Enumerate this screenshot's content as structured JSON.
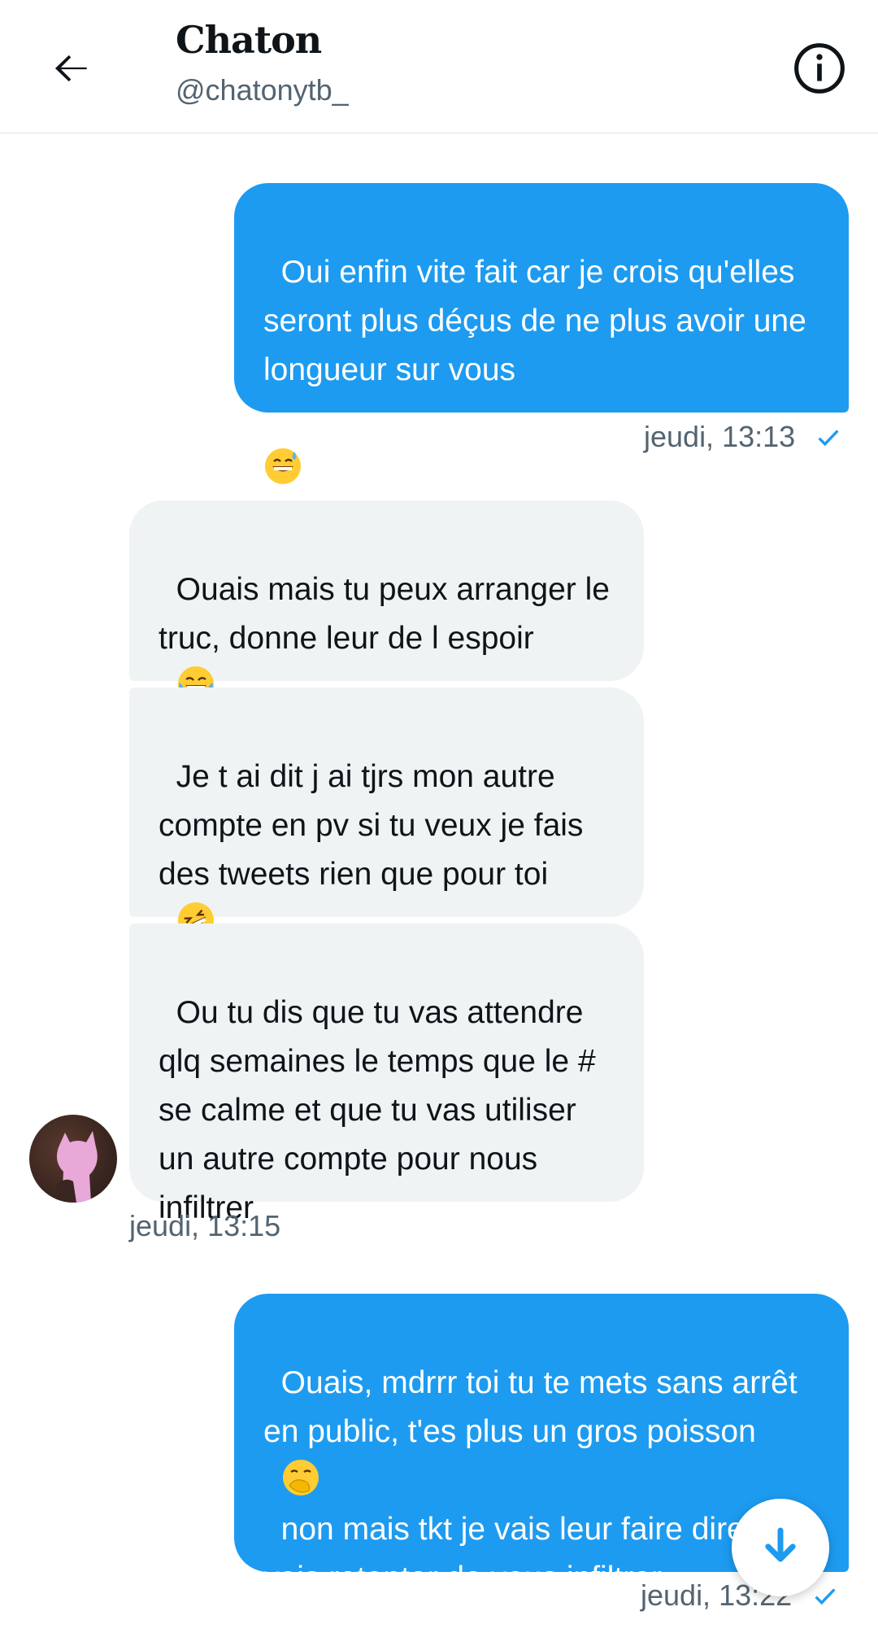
{
  "header": {
    "title": "Chaton",
    "handle": "@chatonytb_",
    "back_icon": "arrow-left-icon",
    "info_icon": "info-icon"
  },
  "colors": {
    "accent": "#1d9bf0",
    "received_bubble": "#eff3f4",
    "secondary_text": "#536471"
  },
  "messages": [
    {
      "direction": "sent",
      "text": "Oui enfin vite fait car je crois qu'elles seront plus déçus de ne plus avoir une longueur sur vous",
      "emoji": "grinning-sweat-emoji",
      "timestamp": "jeudi, 13:13",
      "status": "sent-check-icon"
    },
    {
      "direction": "received",
      "text": "Ouais mais tu peux arranger le truc, donne leur de l espoir",
      "emoji": "tears-of-joy-emoji"
    },
    {
      "direction": "received",
      "text": "Je t ai dit j ai tjrs mon autre compte en pv si tu veux je fais des tweets rien que pour toi",
      "emoji": "rolling-laughing-emoji"
    },
    {
      "direction": "received",
      "text": "Ou tu dis que tu vas attendre qlq semaines le temps que le # se calme et que tu vas utiliser un autre compte pour nous infiltrer",
      "timestamp": "jeudi, 13:15"
    },
    {
      "direction": "sent",
      "text_before": "Ouais, mdrrr toi tu te mets sans arrêt en public, t'es plus un gros poisson",
      "emoji": "hand-over-mouth-emoji",
      "text_after": "non mais tkt je vais leur faire dire je vais retenter de vous infiltrer",
      "timestamp": "jeudi, 13:22",
      "status": "sent-check-icon"
    }
  ],
  "scroll_button_icon": "arrow-down-icon"
}
